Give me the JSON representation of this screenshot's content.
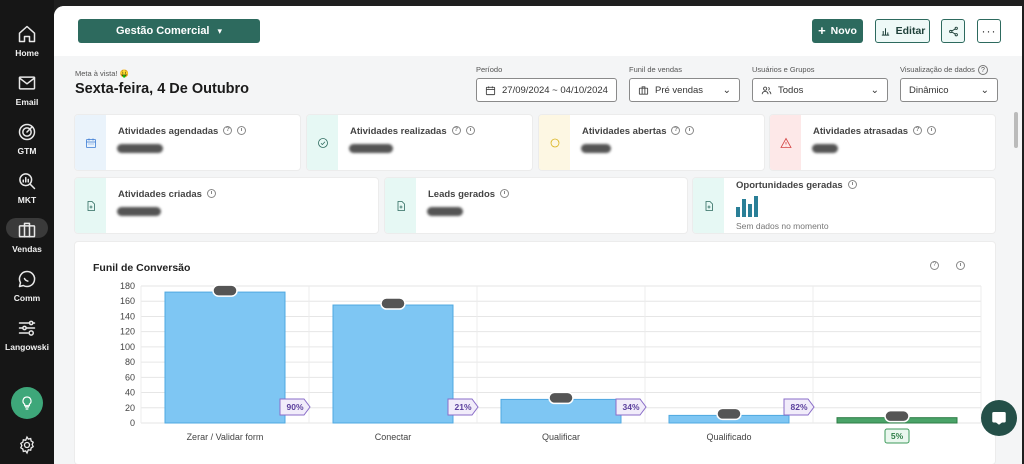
{
  "sidebar": {
    "items": [
      {
        "label": "Home",
        "icon": "home-icon"
      },
      {
        "label": "Email",
        "icon": "mail-icon"
      },
      {
        "label": "GTM",
        "icon": "target-icon"
      },
      {
        "label": "MKT",
        "icon": "search-chart-icon"
      },
      {
        "label": "Vendas",
        "icon": "briefcase-icon"
      },
      {
        "label": "Comm",
        "icon": "chat-bubble-icon"
      },
      {
        "label": "Langowski",
        "icon": "sliders-icon"
      }
    ]
  },
  "topbar": {
    "workspace": "Gestão Comercial",
    "novo_label": "Novo",
    "editar_label": "Editar"
  },
  "header": {
    "tagline": "Meta à vista! 🤑",
    "date_title": "Sexta-feira, 4 De Outubro"
  },
  "filters": {
    "period": {
      "label": "Período",
      "value": "27/09/2024 ~ 04/10/2024"
    },
    "funnel": {
      "label": "Funil de vendas",
      "value": "Pré vendas"
    },
    "users": {
      "label": "Usuários e Grupos",
      "value": "Todos"
    },
    "view": {
      "label": "Visualização de dados",
      "value": "Dinâmico"
    }
  },
  "cards": [
    {
      "title": "Atividades agendadas",
      "color": "#eaf3fb",
      "icon_color": "#3a7bd5"
    },
    {
      "title": "Atividades realizadas",
      "color": "#e6f8f4",
      "icon_color": "#2d6a5e"
    },
    {
      "title": "Atividades abertas",
      "color": "#fdf7e3",
      "icon_color": "#d9b21b"
    },
    {
      "title": "Atividades atrasadas",
      "color": "#fde8e8",
      "icon_color": "#d34545"
    },
    {
      "title": "Atividades criadas",
      "color": "#e6f8f4",
      "icon_color": "#2d6a5e"
    },
    {
      "title": "Leads gerados",
      "color": "#e6f8f4",
      "icon_color": "#2d6a5e"
    },
    {
      "title": "Oportunidades geradas",
      "color": "#e6f8f4",
      "icon_color": "#2d6a5e",
      "subtext": "Sem dados no momento"
    }
  ],
  "chart_data": {
    "type": "bar",
    "title": "Funil de Conversão",
    "categories": [
      "Zerar / Validar form",
      "Conectar",
      "Qualificar",
      "Qualificado",
      ""
    ],
    "values": [
      172,
      155,
      31,
      10,
      7
    ],
    "bar_colors": [
      "#7ec6f3",
      "#7ec6f3",
      "#7ec6f3",
      "#7ec6f3",
      "#4aa368"
    ],
    "conversion_labels": [
      "90%",
      "21%",
      "34%",
      "82%"
    ],
    "final_label": "5%",
    "yticks": [
      0,
      20,
      40,
      60,
      80,
      100,
      120,
      140,
      160,
      180
    ],
    "ylim": [
      0,
      180
    ],
    "grid": true
  }
}
